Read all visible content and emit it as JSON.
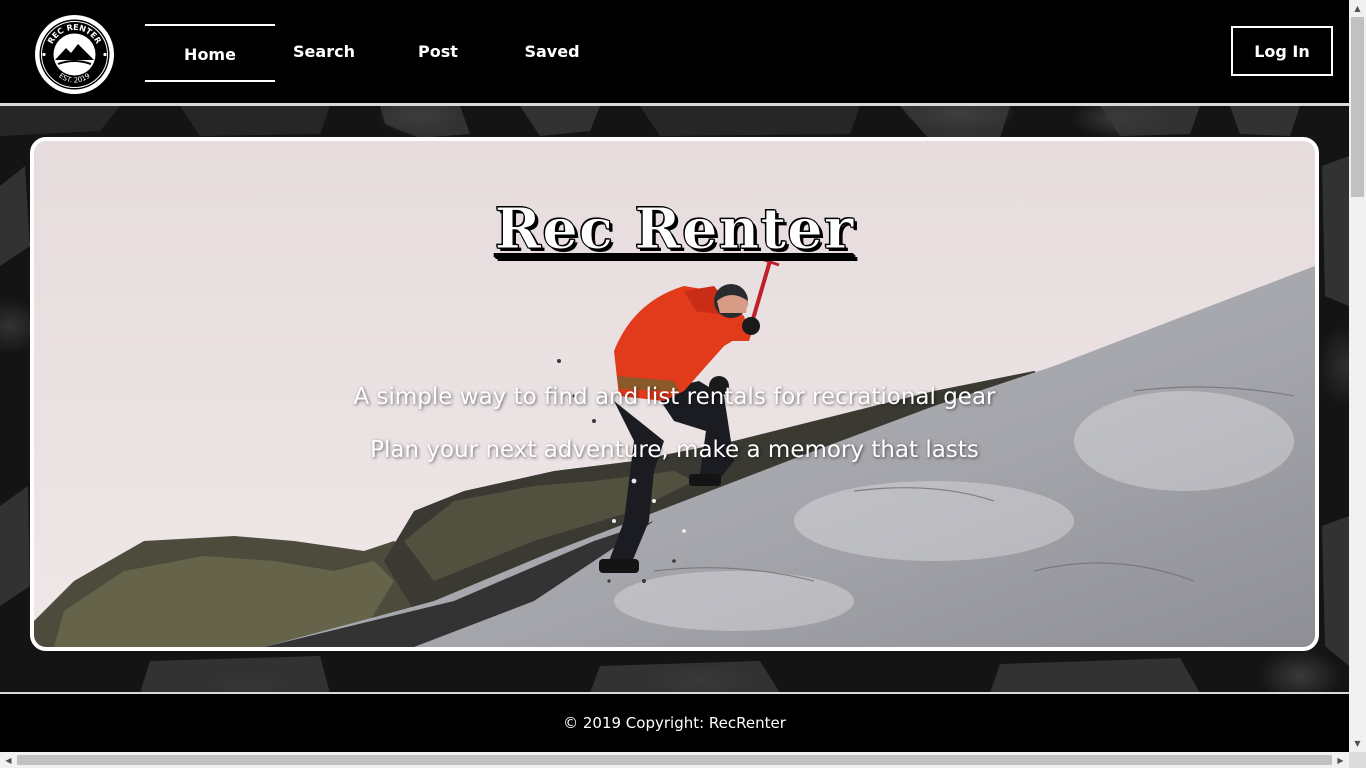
{
  "brand": {
    "logo_text_top": "REC RENTER",
    "logo_text_bottom": "EST. 2019",
    "logo_icon": "mountain-badge-icon"
  },
  "nav": {
    "items": [
      {
        "label": "Home",
        "active": true
      },
      {
        "label": "Search",
        "active": false
      },
      {
        "label": "Post",
        "active": false
      },
      {
        "label": "Saved",
        "active": false
      }
    ],
    "login_label": "Log In"
  },
  "hero": {
    "title": "Rec Renter",
    "tagline_1": "A simple way to find and list rentals for recrational gear",
    "tagline_2": "Plan your next adventure, make a memory that lasts"
  },
  "footer": {
    "copyright": "© 2019 Copyright: RecRenter"
  },
  "colors": {
    "nav_bg": "#000000",
    "accent": "#ffffff",
    "jacket": "#e23b1c"
  }
}
